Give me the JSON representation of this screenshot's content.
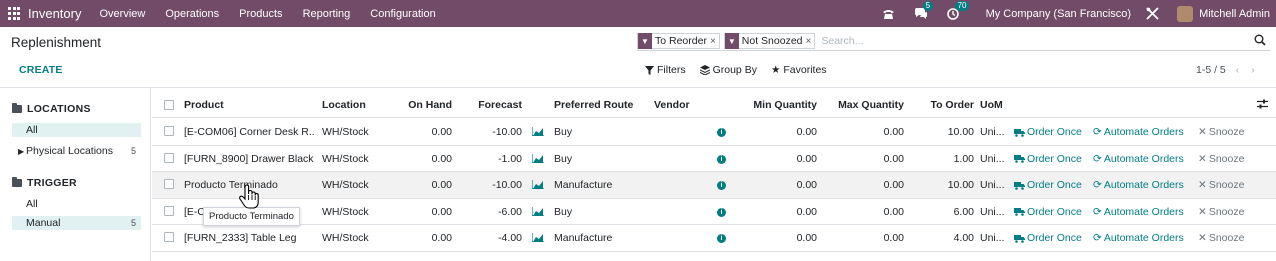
{
  "navbar": {
    "app_name": "Inventory",
    "menu": [
      "Overview",
      "Operations",
      "Products",
      "Reporting",
      "Configuration"
    ],
    "messages_badge": "5",
    "activity_badge": "70",
    "company": "My Company (San Francisco)",
    "user": "Mitchell Admin"
  },
  "page": {
    "title": "Replenishment",
    "create_label": "CREATE"
  },
  "search": {
    "facets": [
      "To Reorder",
      "Not Snoozed"
    ],
    "placeholder": "Search..."
  },
  "controls": {
    "filters": "Filters",
    "group_by": "Group By",
    "favorites": "Favorites",
    "pager": "1-5 / 5"
  },
  "sidepanel": {
    "locations_title": "LOCATIONS",
    "locations": [
      {
        "label": "All",
        "count": ""
      },
      {
        "label": "Physical Locations",
        "count": "5"
      }
    ],
    "trigger_title": "TRIGGER",
    "triggers": [
      {
        "label": "All",
        "count": ""
      },
      {
        "label": "Manual",
        "count": "5"
      }
    ]
  },
  "table": {
    "headers": {
      "product": "Product",
      "location": "Location",
      "on_hand": "On Hand",
      "forecast": "Forecast",
      "route": "Preferred Route",
      "vendor": "Vendor",
      "min_qty": "Min Quantity",
      "max_qty": "Max Quantity",
      "to_order": "To Order",
      "uom": "UoM"
    },
    "buttons": {
      "order_once": "Order Once",
      "automate": "Automate Orders",
      "snooze": "Snooze"
    },
    "rows": [
      {
        "product": "[E-COM06] Corner Desk R...",
        "location": "WH/Stock",
        "on_hand": "0.00",
        "forecast": "-10.00",
        "route": "Buy",
        "min_qty": "0.00",
        "max_qty": "0.00",
        "to_order": "10.00",
        "uom": "Uni..."
      },
      {
        "product": "[FURN_8900] Drawer Black",
        "location": "WH/Stock",
        "on_hand": "0.00",
        "forecast": "-1.00",
        "route": "Buy",
        "min_qty": "0.00",
        "max_qty": "0.00",
        "to_order": "1.00",
        "uom": "Uni..."
      },
      {
        "product": "Producto Terminado",
        "location": "WH/Stock",
        "on_hand": "0.00",
        "forecast": "-10.00",
        "route": "Manufacture",
        "min_qty": "0.00",
        "max_qty": "0.00",
        "to_order": "10.00",
        "uom": "Uni..."
      },
      {
        "product": "[E-C",
        "location": "WH/Stock",
        "on_hand": "0.00",
        "forecast": "-6.00",
        "route": "Buy",
        "min_qty": "0.00",
        "max_qty": "0.00",
        "to_order": "6.00",
        "uom": "Uni..."
      },
      {
        "product": "[FURN_2333] Table Leg",
        "location": "WH/Stock",
        "on_hand": "0.00",
        "forecast": "-4.00",
        "route": "Manufacture",
        "min_qty": "0.00",
        "max_qty": "0.00",
        "to_order": "4.00",
        "uom": "Uni..."
      }
    ]
  },
  "tooltip": "Producto Terminado",
  "colors": {
    "brand": "#714b67",
    "accent": "#017e84"
  }
}
